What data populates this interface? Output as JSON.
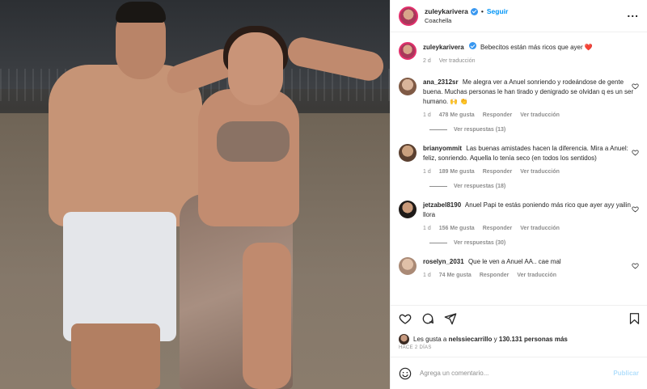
{
  "post": {
    "username": "zuleykarivera",
    "follow_label": "Seguir",
    "location": "Coachella",
    "more_label": "..."
  },
  "caption": {
    "username": "zuleykarivera",
    "text": "Bebecitos están más ricos que ayer ❤️",
    "time": "2 d",
    "translate": "Ver traducción"
  },
  "comments": [
    {
      "username": "ana_2312sr",
      "text": "Me alegra ver a Anuel sonriendo y rodeándose de gente buena. Muchas personas le han tirado y denigrado se olvidan q es un ser humano. 🙌 👏",
      "time": "1 d",
      "likes": "478 Me gusta",
      "reply": "Responder",
      "translate": "Ver traducción",
      "replies": "Ver respuestas (13)"
    },
    {
      "username": "brianyommit",
      "text": "Las buenas amistades hacen la diferencia. Mira a Anuel: feliz, sonriendo. Aquella lo tenía seco (en todos los sentidos)",
      "time": "1 d",
      "likes": "189 Me gusta",
      "reply": "Responder",
      "translate": "Ver traducción",
      "replies": "Ver respuestas (18)"
    },
    {
      "username": "jetzabel8190",
      "text": "Anuel Papi te estás poniendo más rico que ayer ayy yailin llora",
      "time": "1 d",
      "likes": "156 Me gusta",
      "reply": "Responder",
      "translate": "Ver traducción",
      "replies": "Ver respuestas (30)"
    },
    {
      "username": "roselyn_2031",
      "text": "Que le ven a Anuel AA.. cae mal",
      "time": "1 d",
      "likes": "74 Me gusta",
      "reply": "Responder",
      "translate": "Ver traducción"
    }
  ],
  "likes": {
    "prefix": "Les gusta a",
    "user": "nelssiecarrillo",
    "middle": "y",
    "count": "130.131 personas más"
  },
  "ago": "HACE 2 DÍAS",
  "add_comment": {
    "placeholder": "Agrega un comentario...",
    "publish": "Publicar"
  },
  "colors": {
    "accent": "#0095f6",
    "muted": "#8e8e8e",
    "verified": "#3897f0",
    "heart": "#ed4956"
  },
  "icons": [
    "heart-icon",
    "comment-icon",
    "share-icon",
    "bookmark-icon",
    "emoji-icon",
    "verified-icon",
    "more-icon"
  ]
}
